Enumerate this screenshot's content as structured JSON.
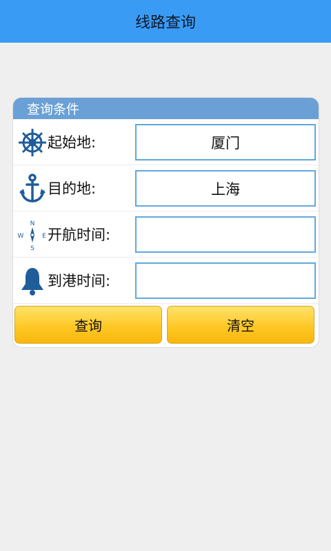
{
  "title": "线路查询",
  "panel": {
    "header": "查询条件",
    "rows": [
      {
        "label": "起始地:",
        "value": "厦门",
        "icon": "ship-wheel-icon"
      },
      {
        "label": "目的地:",
        "value": "上海",
        "icon": "anchor-icon"
      },
      {
        "label": "开航时间:",
        "value": "",
        "icon": "compass-icon"
      },
      {
        "label": "到港时间:",
        "value": "",
        "icon": "bell-icon"
      }
    ],
    "buttons": {
      "query": "查询",
      "clear": "清空"
    }
  },
  "colors": {
    "titlebar": "#3a9bf5",
    "panel_header": "#6aa0d6",
    "icon": "#1f5d9a",
    "button": "#ffc826"
  }
}
